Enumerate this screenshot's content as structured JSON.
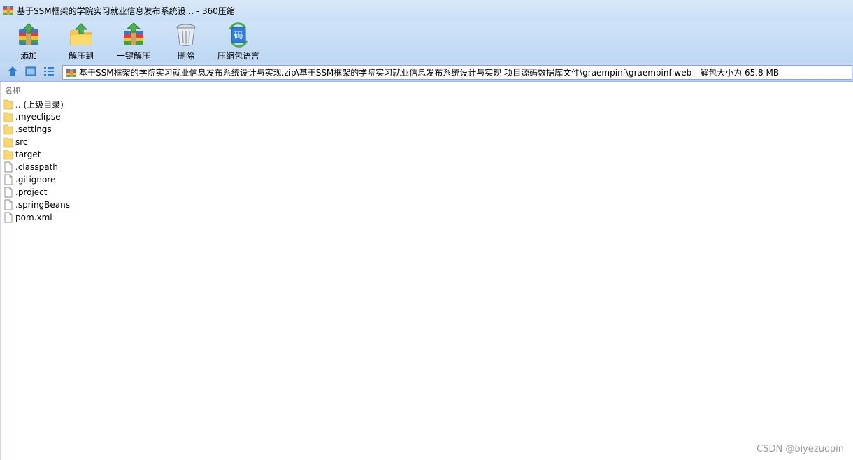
{
  "window": {
    "title": "基于SSM框架的学院实习就业信息发布系统设... - 360压缩"
  },
  "toolbar": {
    "buttons": [
      {
        "label": "添加",
        "icon": "add-archive-icon"
      },
      {
        "label": "解压到",
        "icon": "extract-to-icon"
      },
      {
        "label": "一键解压",
        "icon": "one-click-extract-icon"
      },
      {
        "label": "删除",
        "icon": "delete-trash-icon"
      },
      {
        "label": "压缩包语言",
        "icon": "archive-language-icon",
        "icon_text": "码"
      }
    ]
  },
  "address": {
    "path": "基于SSM框架的学院实习就业信息发布系统设计与实现.zip\\基于SSM框架的学院实习就业信息发布系统设计与实现 项目源码数据库文件\\graempinf\\graempinf-web - 解包大小为 65.8 MB"
  },
  "list": {
    "column_name": "名称",
    "items": [
      {
        "name": ".. (上级目录)",
        "type": "folder"
      },
      {
        "name": ".myeclipse",
        "type": "folder"
      },
      {
        "name": ".settings",
        "type": "folder"
      },
      {
        "name": "src",
        "type": "folder"
      },
      {
        "name": "target",
        "type": "folder"
      },
      {
        "name": ".classpath",
        "type": "file"
      },
      {
        "name": ".gitignore",
        "type": "file"
      },
      {
        "name": ".project",
        "type": "file"
      },
      {
        "name": ".springBeans",
        "type": "file"
      },
      {
        "name": "pom.xml",
        "type": "file"
      }
    ]
  },
  "watermark": "CSDN @biyezuopin",
  "colors": {
    "titlebar": "#d4e6f8",
    "toolbar": "#c6dcf5",
    "folder": "#f8d775",
    "accent_blue": "#2f7fd8"
  }
}
